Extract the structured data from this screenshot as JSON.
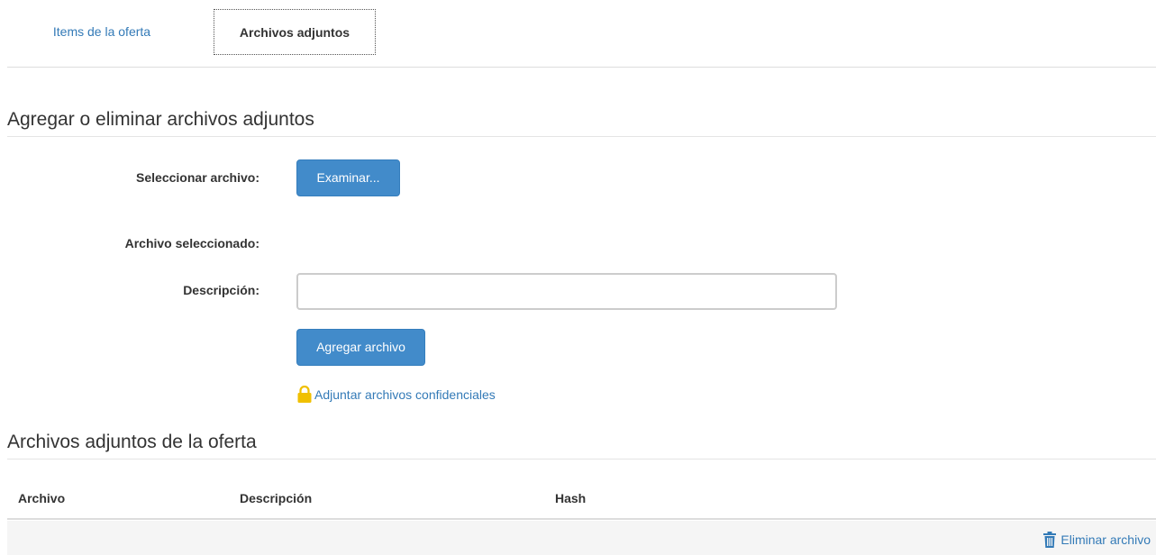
{
  "tabs": [
    {
      "label": "Items de la oferta",
      "active": false
    },
    {
      "label": "Archivos adjuntos",
      "active": true
    }
  ],
  "upload_section": {
    "title": "Agregar o eliminar archivos adjuntos",
    "select_file_label": "Seleccionar archivo:",
    "browse_button": "Examinar...",
    "selected_file_label": "Archivo seleccionado:",
    "selected_file_value": "",
    "description_label": "Descripción:",
    "description_value": "",
    "add_button": "Agregar archivo",
    "confidential_link": "Adjuntar archivos confidenciales"
  },
  "attachments_section": {
    "title": "Archivos adjuntos de la oferta",
    "columns": [
      "Archivo",
      "Descripción",
      "Hash"
    ],
    "delete_link": "Eliminar archivo"
  },
  "icons": {
    "lock": "lock-icon",
    "trash": "trash-icon"
  },
  "colors": {
    "primary_button": "#428bca",
    "link": "#337ab7",
    "lock": "#f0c000",
    "row_background": "#f5f5f5"
  }
}
